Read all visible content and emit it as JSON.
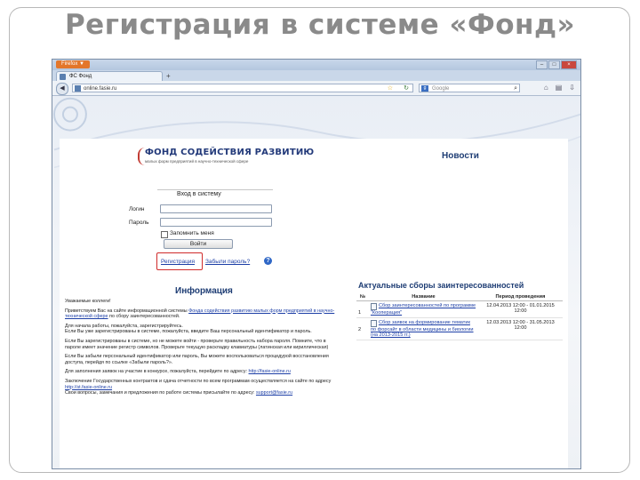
{
  "slide": {
    "title": "Регистрация в системе «Фонд»"
  },
  "browser": {
    "menu_label": "Firefox ▼",
    "tab_title": "ФС Фонд",
    "tab_add": "+",
    "url": "online.fasie.ru",
    "search_placeholder": "Google"
  },
  "site": {
    "logo_title": "ФОНД СОДЕЙСТВИЯ РАЗВИТИЮ",
    "logo_subtitle": "малых форм предприятий в научно-технической сфере",
    "news_title": "Новости",
    "login": {
      "title": "Вход в систему",
      "login_label": "Логин",
      "password_label": "Пароль",
      "remember_label": "Запомнить меня",
      "submit_label": "Войти",
      "register_link": "Регистрация",
      "forgot_link": "Забыли пароль?"
    },
    "info": {
      "title": "Информация",
      "greeting": "Уважаемые коллеги!",
      "p1_pre": "Приветствуем Вас на сайте информационной системы ",
      "p1_link": "Фонда содействия развитию малых форм предприятий в научно-технической сфере",
      "p1_post": " по сбору заинтересованностей.",
      "p2": "Для начала работы, пожалуйста, зарегистрируйтесь.",
      "p3": "Если Вы уже зарегистрированы в системе, пожалуйста, введите Ваш персональный идентификатор и пароль.",
      "p4": "Если Вы зарегистрированы в системе, но не можете войти - проверьте правильность набора пароля. Помните, что в пароле имеет значение регистр символов. Проверьте текущую раскладку клавиатуры (латинская или кириллическая)",
      "p5": "Если Вы забыли персональный идентификатор или пароль, Вы можете воспользоваться процедурой восстановления доступа, перейдя по ссылке «Забыли пароль?».",
      "p6_pre": "Для заполнения заявок на участие в конкурсе, пожалуйста, перейдите по адресу: ",
      "p6_link": "http://fasie-online.ru",
      "p7_pre": "Заключение Государственных контрактов и сдача отчетности по всем программам осуществляется на сайте по адресу ",
      "p7_link": "http://st.fasie-online.ru",
      "p8_pre": "Свои вопросы, замечания и предложения по работе системы присылайте по адресу: ",
      "p8_link": "support@fasie.ru"
    },
    "fund": {
      "title": "Актуальные сборы заинтересованностей",
      "headers": [
        "№",
        "Название",
        "Период проведения"
      ],
      "rows": [
        {
          "num": "1",
          "name": "Сбор заинтересованностей по программе \"Кооперация\"",
          "period": "12.04.2013 12:00 - 01.01.2015 12:00"
        },
        {
          "num": "2",
          "name": "Сбор заявок на формирование тематик по форсайт в области медицины и биологии (на 2013-2015 гг.)",
          "period": "12.03.2013 12:00 - 31.05.2013 12:00"
        }
      ]
    }
  },
  "colors": {
    "accent_red": "#d02b2b",
    "brand_blue": "#1e3d74",
    "link_blue": "#1d3fa6"
  }
}
